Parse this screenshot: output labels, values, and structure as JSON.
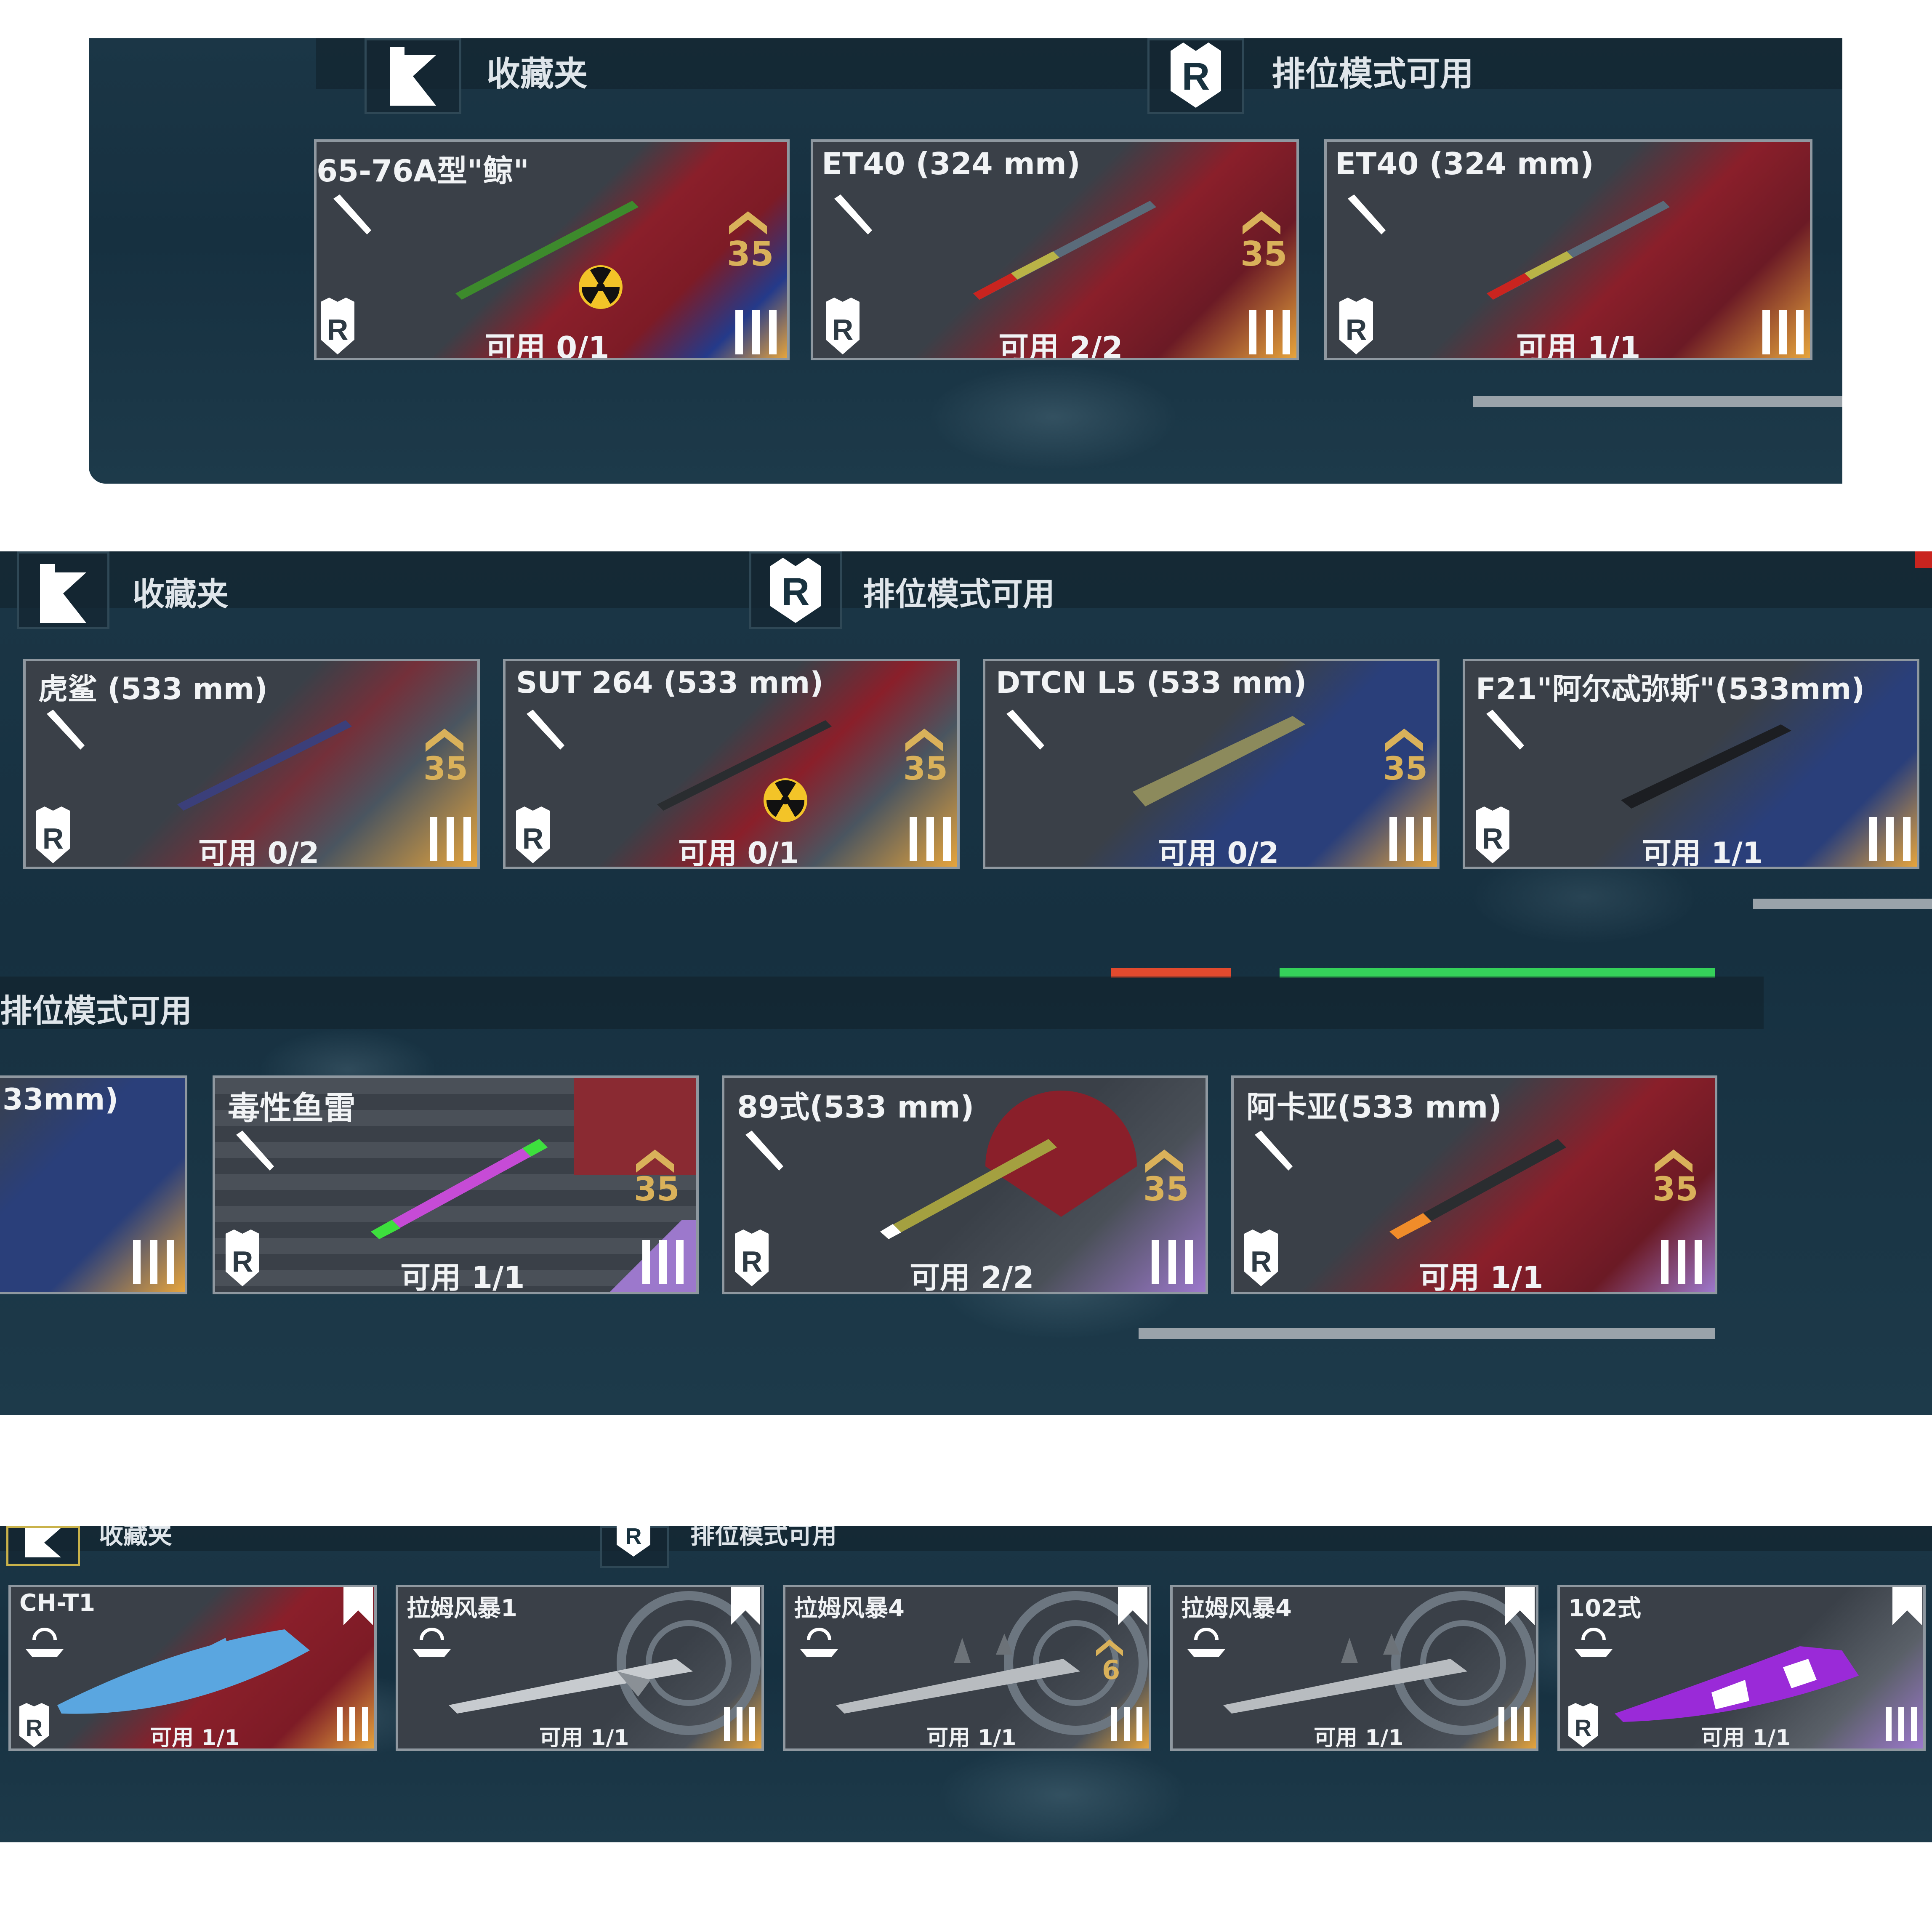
{
  "headers": {
    "favorites": "收藏夹",
    "ranked": "排位模式可用"
  },
  "colors": {
    "card_frame": "#8f98a0",
    "gold_tier": "#e6a43c",
    "purple_tier": "#9c78cc",
    "rank_badge": "#d9b15a",
    "health_red": "#e24a2e",
    "health_green": "#35d15a"
  },
  "icons": {
    "favorites": "bookmark-flag-icon",
    "ranked": "ranked-shield-r-icon",
    "torpedo_type": "torpedo-icon",
    "drone_type": "underwater-drone-icon",
    "nuclear": "radiation-icon",
    "rank_up": "chevron-rank-icon",
    "tier": "tier-three-bars-icon"
  },
  "section1": {
    "cards": [
      {
        "name": "65-76A型\"鲸\"",
        "avail": "可用 0/1",
        "rank": "35",
        "nuclear": true
      },
      {
        "name": "ET40 (324 mm)",
        "avail": "可用 2/2",
        "rank": "35",
        "nuclear": false
      },
      {
        "name": "ET40 (324 mm)",
        "avail": "可用 1/1",
        "rank": "",
        "nuclear": false
      }
    ]
  },
  "section2": {
    "row1": [
      {
        "name": "虎鲨 (533 mm)",
        "avail": "可用 0/2",
        "rank": "35",
        "nuclear": false
      },
      {
        "name": "SUT 264 (533 mm)",
        "avail": "可用 0/1",
        "rank": "35",
        "nuclear": true
      },
      {
        "name": "DTCN L5 (533 mm)",
        "avail": "可用 0/2",
        "rank": "35",
        "nuclear": false
      },
      {
        "name": "F21\"阿尔忒弥斯\"(533mm)",
        "avail": "可用 1/1",
        "rank": "",
        "nuclear": false
      }
    ],
    "row2": [
      {
        "name": "33mm)",
        "avail": "",
        "rank": "",
        "nuclear": false
      },
      {
        "name": "毒性鱼雷",
        "avail": "可用 1/1",
        "rank": "35",
        "nuclear": false
      },
      {
        "name": "89式(533 mm)",
        "avail": "可用 2/2",
        "rank": "35",
        "nuclear": false
      },
      {
        "name": "阿卡亚(533 mm)",
        "avail": "可用 1/1",
        "rank": "35",
        "nuclear": false
      }
    ]
  },
  "section3": {
    "cards": [
      {
        "name": "CH-T1",
        "avail": "可用 1/1",
        "rank": ""
      },
      {
        "name": "拉姆风暴1",
        "avail": "可用 1/1",
        "rank": ""
      },
      {
        "name": "拉姆风暴4",
        "avail": "可用 1/1",
        "rank": "6"
      },
      {
        "name": "拉姆风暴4",
        "avail": "可用 1/1",
        "rank": ""
      },
      {
        "name": "102式",
        "avail": "可用 1/1",
        "rank": ""
      }
    ]
  }
}
